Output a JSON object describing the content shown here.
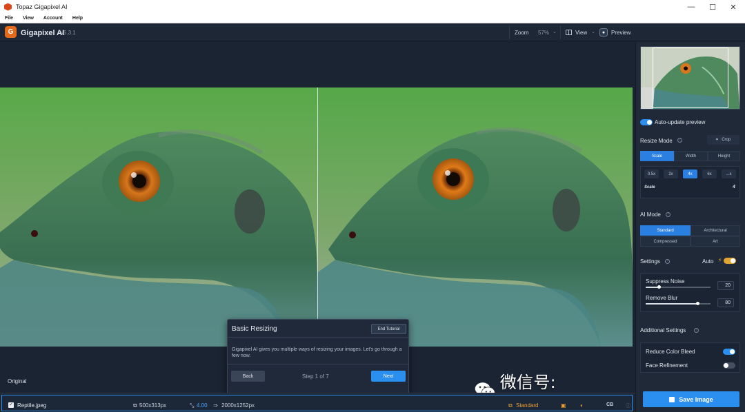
{
  "window": {
    "title": "Topaz Gigapixel AI",
    "controls": {
      "minimize": "—",
      "maximize": "☐",
      "close": "✕"
    }
  },
  "menubar": {
    "items": [
      "File",
      "View",
      "Account",
      "Help"
    ]
  },
  "header": {
    "logo_letter": "G",
    "app_name": "Gigapixel AI",
    "version": "v5.3.1",
    "zoom_label": "Zoom",
    "zoom_value": "57%",
    "view_label": "View",
    "preview_label": "Preview",
    "chevron": "⌄"
  },
  "canvas": {
    "original_label": "Original",
    "colors": {
      "bg_top": "#5cae4a",
      "bg_bottom": "#9aa696",
      "lizard": "#3f7a52",
      "eye": "#d8761b"
    }
  },
  "tutorial": {
    "title": "Basic Resizing",
    "end_button": "End Tutorial",
    "body": "Gigapixel AI gives you multiple ways of resizing your images. Let's go through a few now.",
    "back_button": "Back",
    "step_text": "Step 1 of 7",
    "next_button": "Next"
  },
  "watermark": {
    "text": "微信号: PHOTOSHOPTEA"
  },
  "bottombar": {
    "file_name": "Reptile.jpeg",
    "check": "✓",
    "source_size": "500x313px",
    "scale": "4.00",
    "output_size": "2000x1252px",
    "model": "Standard",
    "cb": "CB",
    "info": "ⓘ",
    "icons": {
      "source": "⧉",
      "scale": "⤡",
      "output": "⇒",
      "model": "⧉",
      "box": "▣",
      "wand": "◐"
    }
  },
  "sidebar": {
    "auto_update_label": "Auto-update preview",
    "auto_update_on": true,
    "resize_mode": {
      "title": "Resize Mode",
      "help": "?",
      "crop_label": "Crop",
      "tabs": [
        "Scale",
        "Width",
        "Height"
      ],
      "active_tab": "Scale",
      "chips": [
        "0.5x",
        "2x",
        "4x",
        "6x",
        "...x"
      ],
      "active_chip": "4x",
      "scale_label": "Scale",
      "scale_value": "4"
    },
    "ai_mode": {
      "title": "AI Mode",
      "help": "?",
      "options": [
        "Standard",
        "Architectural",
        "Compressed",
        "Art"
      ],
      "active": "Standard"
    },
    "settings": {
      "title": "Settings",
      "help": "?",
      "auto_label": "Auto",
      "bolt": "⚡",
      "suppress_noise_label": "Suppress Noise",
      "suppress_noise_value": "20",
      "suppress_noise_level": 0.2,
      "remove_blur_label": "Remove Blur",
      "remove_blur_value": "80",
      "remove_blur_level": 0.8
    },
    "additional": {
      "title": "Additional Settings",
      "help": "?",
      "reduce_color_bleed_label": "Reduce Color Bleed",
      "reduce_color_bleed_on": true,
      "face_refinement_label": "Face Refinement",
      "face_refinement_on": false
    },
    "save_label": "Save Image"
  }
}
